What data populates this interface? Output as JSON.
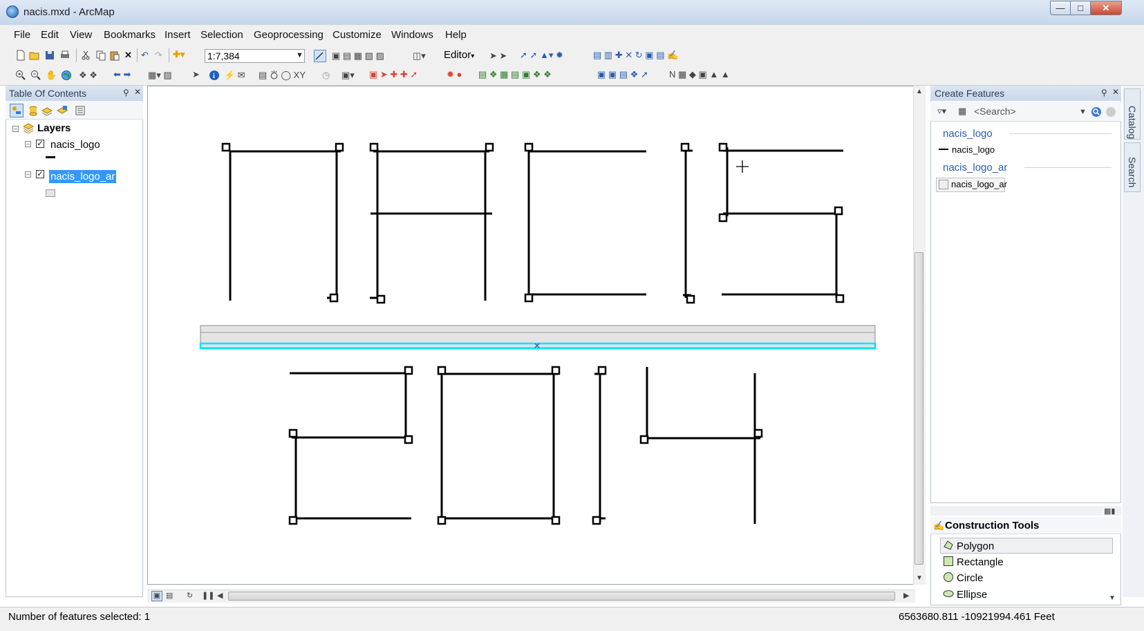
{
  "window": {
    "title": "nacis.mxd - ArcMap"
  },
  "menu": [
    "File",
    "Edit",
    "View",
    "Bookmarks",
    "Insert",
    "Selection",
    "Geoprocessing",
    "Customize",
    "Windows",
    "Help"
  ],
  "toolbar": {
    "scale": "1:7,384",
    "editor_label": "Editor"
  },
  "toc": {
    "title": "Table Of Contents",
    "root": "Layers",
    "layers": [
      {
        "name": "nacis_logo",
        "checked": true,
        "symbol": "line"
      },
      {
        "name": "nacis_logo_ar",
        "checked": true,
        "symbol": "polygon",
        "selected": true
      }
    ]
  },
  "create_features": {
    "title": "Create Features",
    "search_placeholder": "<Search>",
    "groups": [
      {
        "name": "nacis_logo",
        "template": "nacis_logo"
      },
      {
        "name": "nacis_logo_ar",
        "template": "nacis_logo_ar"
      }
    ]
  },
  "construction_tools": {
    "title": "Construction Tools",
    "items": [
      "Polygon",
      "Rectangle",
      "Circle",
      "Ellipse"
    ],
    "selected": "Polygon"
  },
  "side_tabs": [
    "Catalog",
    "Search"
  ],
  "status": {
    "text": "Number of features selected: 1",
    "coords": "6563680.811  -10921994.461 Feet"
  },
  "icons": [
    "app-globe-icon",
    "new-icon",
    "open-icon",
    "save-icon",
    "print-icon",
    "cut-icon",
    "copy-icon",
    "paste-icon",
    "delete-icon",
    "undo-icon",
    "redo-icon",
    "add-data-icon",
    "zoom-in-icon",
    "zoom-out-icon",
    "pan-icon",
    "full-extent-icon",
    "identify-icon",
    "select-icon",
    "pin-icon",
    "close-icon",
    "search-icon",
    "checkmark-icon"
  ],
  "colors": {
    "selection": "#00e5ff",
    "highlight": "#3399ff",
    "group_text": "#2a5db0"
  }
}
